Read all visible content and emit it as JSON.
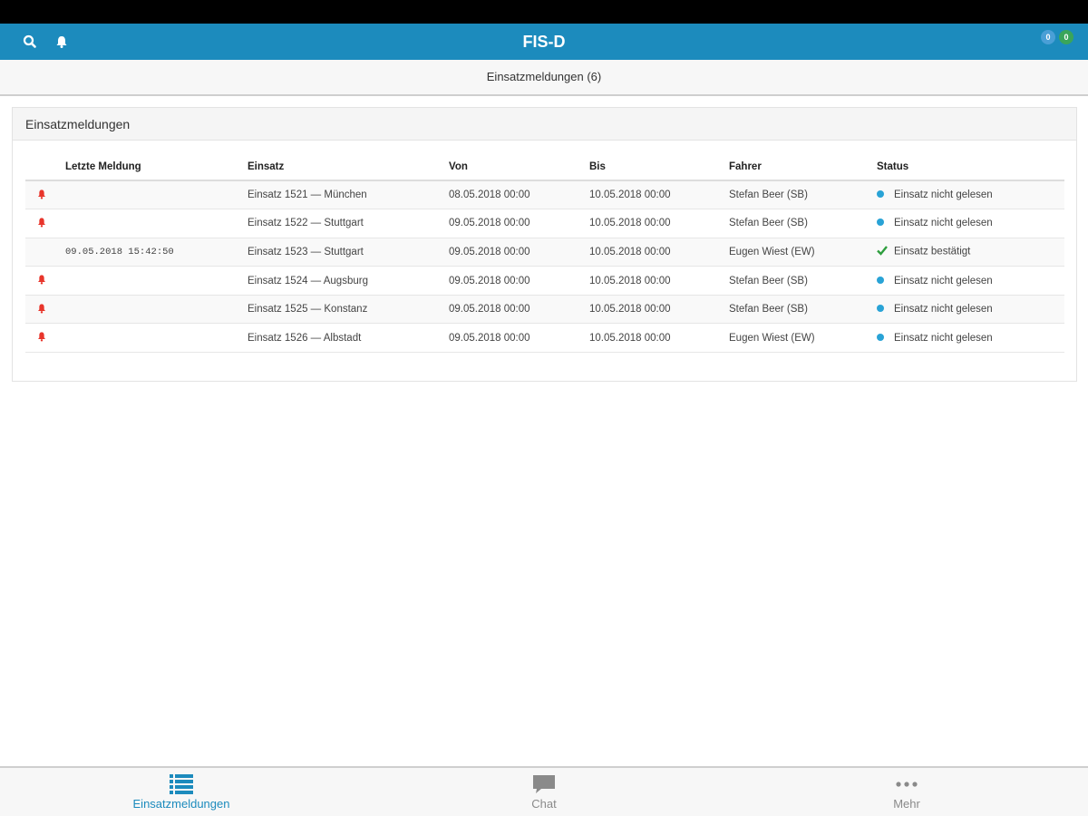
{
  "header": {
    "title": "FIS-D",
    "badges": [
      {
        "value": "0",
        "color": "#4a9fd6"
      },
      {
        "value": "0",
        "color": "#3aa55a"
      }
    ]
  },
  "subheader": {
    "title": "Einsatzmeldungen (6)"
  },
  "panel": {
    "title": "Einsatzmeldungen",
    "columns": [
      "",
      "Letzte Meldung",
      "Einsatz",
      "Von",
      "Bis",
      "Fahrer",
      "Status"
    ],
    "rows": [
      {
        "alert": true,
        "last": "",
        "einsatz": "Einsatz 1521 — München",
        "von": "08.05.2018 00:00",
        "bis": "10.05.2018 00:00",
        "fahrer": "Stefan Beer (SB)",
        "status": "Einsatz nicht gelesen",
        "status_type": "unread"
      },
      {
        "alert": true,
        "last": "",
        "einsatz": "Einsatz 1522 — Stuttgart",
        "von": "09.05.2018 00:00",
        "bis": "10.05.2018 00:00",
        "fahrer": "Stefan Beer (SB)",
        "status": "Einsatz nicht gelesen",
        "status_type": "unread"
      },
      {
        "alert": false,
        "last": "09.05.2018 15:42:50",
        "einsatz": "Einsatz 1523 — Stuttgart",
        "von": "09.05.2018 00:00",
        "bis": "10.05.2018 00:00",
        "fahrer": "Eugen Wiest (EW)",
        "status": "Einsatz bestätigt",
        "status_type": "confirmed"
      },
      {
        "alert": true,
        "last": "",
        "einsatz": "Einsatz 1524 — Augsburg",
        "von": "09.05.2018 00:00",
        "bis": "10.05.2018 00:00",
        "fahrer": "Stefan Beer (SB)",
        "status": "Einsatz nicht gelesen",
        "status_type": "unread"
      },
      {
        "alert": true,
        "last": "",
        "einsatz": "Einsatz 1525 — Konstanz",
        "von": "09.05.2018 00:00",
        "bis": "10.05.2018 00:00",
        "fahrer": "Stefan Beer (SB)",
        "status": "Einsatz nicht gelesen",
        "status_type": "unread"
      },
      {
        "alert": true,
        "last": "",
        "einsatz": "Einsatz 1526 — Albstadt",
        "von": "09.05.2018 00:00",
        "bis": "10.05.2018 00:00",
        "fahrer": "Eugen Wiest (EW)",
        "status": "Einsatz nicht gelesen",
        "status_type": "unread"
      }
    ]
  },
  "tabs": [
    {
      "label": "Einsatzmeldungen",
      "icon": "list-icon",
      "active": true
    },
    {
      "label": "Chat",
      "icon": "chat-icon",
      "active": false
    },
    {
      "label": "Mehr",
      "icon": "more-icon",
      "active": false
    }
  ],
  "colors": {
    "accent": "#1c8bbd",
    "alert": "#e8352b",
    "unread": "#29a3d6",
    "confirmed": "#2e9e3e",
    "tab_inactive": "#8a8a8a"
  }
}
